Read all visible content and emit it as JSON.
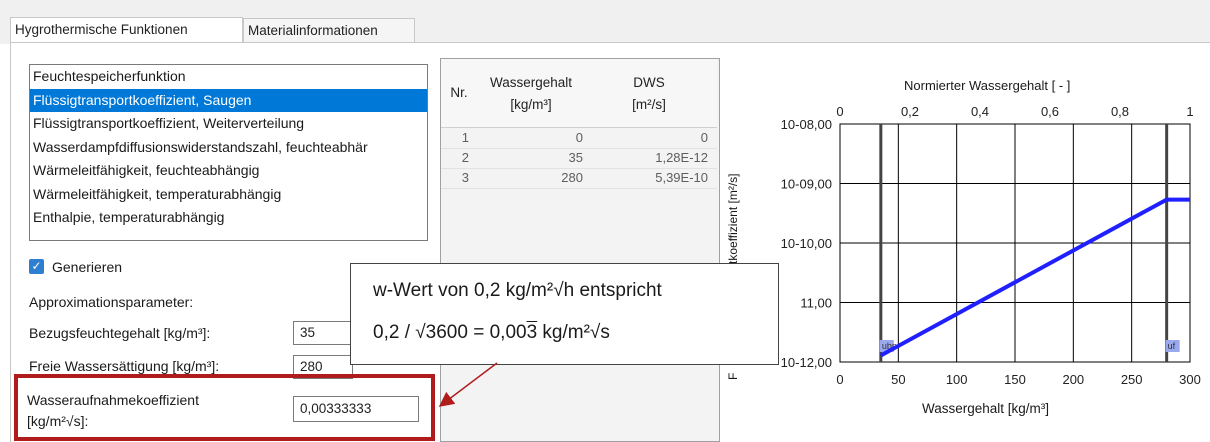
{
  "tabs": [
    {
      "label": "Hygrothermische Funktionen",
      "active": true
    },
    {
      "label": "Materialinformationen",
      "active": false
    }
  ],
  "function_list": {
    "items": [
      "Feuchtespeicherfunktion",
      "Flüssigtransportkoeffizient, Saugen",
      "Flüssigtransportkoeffizient, Weiterverteilung",
      "Wasserdampfdiffusionswiderstandszahl, feuchteabhär",
      "Wärmeleitfähigkeit, feuchteabhängig",
      "Wärmeleitfähigkeit, temperaturabhängig",
      "Enthalpie, temperaturabhängig"
    ],
    "selected_index": 1
  },
  "generate": {
    "label": "Generieren",
    "checked": true
  },
  "approx": {
    "heading": "Approximationsparameter:",
    "ref_moisture_label": "Bezugsfeuchtegehalt [kg/m³]:",
    "ref_moisture_value": "35",
    "free_saturation_label": "Freie Wassersättigung [kg/m³]:",
    "free_saturation_value": "280",
    "absorption_label_line1": "Wasseraufnahmekoeffizient",
    "absorption_label_line2": "[kg/m²√s]:",
    "absorption_value": "0,00333333"
  },
  "table": {
    "headers": {
      "nr": "Nr.",
      "water_line1": "Wassergehalt",
      "water_line2": "[kg/m³]",
      "dws_line1": "DWS",
      "dws_line2": "[m²/s]"
    },
    "rows": [
      {
        "nr": "1",
        "water": "0",
        "dws": "0"
      },
      {
        "nr": "2",
        "water": "35",
        "dws": "1,28E-12"
      },
      {
        "nr": "3",
        "water": "280",
        "dws": "5,39E-10"
      }
    ]
  },
  "callout": {
    "line1": "w-Wert von 0,2 kg/m²√h entspricht",
    "line2_prefix": "0,2 / √3600 = 0,00",
    "line2_overlined": "3",
    "line2_suffix": " kg/m²√s"
  },
  "chart_data": {
    "type": "line",
    "top_axis_title": "Normierter Wassergehalt [ - ]",
    "top_ticks": [
      "0",
      "0,2",
      "0,4",
      "0,6",
      "0,8",
      "1"
    ],
    "xlabel": "Wassergehalt [kg/m³]",
    "x_ticks": [
      "0",
      "50",
      "100",
      "150",
      "200",
      "250",
      "300"
    ],
    "xlim": [
      0,
      300
    ],
    "ylabel_visible_fragment": "F",
    "ylabel_visible_rest": "ortkoeffizient [m²/s]",
    "y_ticks": [
      "10-08,00",
      "10-09,00",
      "10-10,00",
      "11,00",
      "10-12,00"
    ],
    "y_scale": "log",
    "series": [
      {
        "x": [
          35,
          280,
          300
        ],
        "y": [
          -11.89,
          -9.27,
          -9.27
        ],
        "color": "#1f1fff"
      }
    ],
    "markers": [
      {
        "label": "ubp",
        "x": 35
      },
      {
        "label": "uf",
        "x": 280
      }
    ],
    "grid": true
  }
}
